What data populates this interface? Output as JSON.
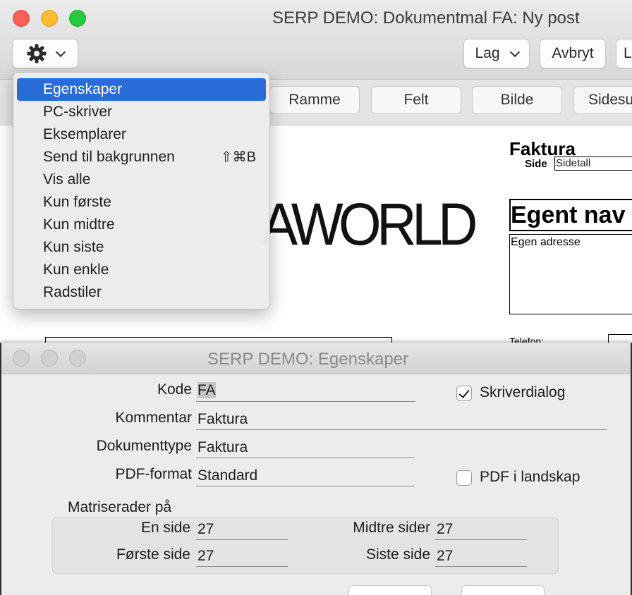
{
  "main_window": {
    "title": "SERP DEMO: Dokumentmal FA: Ny post",
    "toolbar": {
      "lag_label": "Lag",
      "avbryt_label": "Avbryt",
      "l_label": "L"
    },
    "tabs": [
      {
        "label": "Ramme"
      },
      {
        "label": "Felt"
      },
      {
        "label": "Bilde"
      },
      {
        "label": "Sidesu"
      }
    ],
    "document": {
      "logo_text": "AWORLD",
      "faktura_heading": "Faktura",
      "side_label": "Side",
      "sidetall_value": "Sidetall",
      "egent_navn": "Egent nav",
      "egen_adresse": "Egen adresse",
      "telefon_label": "Telefon:"
    }
  },
  "gear_menu": {
    "items": [
      {
        "label": "Egenskaper",
        "shortcut": "",
        "selected": true
      },
      {
        "label": "PC-skriver",
        "shortcut": ""
      },
      {
        "label": "Eksemplarer",
        "shortcut": ""
      },
      {
        "label": "Send til bakgrunnen",
        "shortcut": "⇧⌘B"
      },
      {
        "label": "Vis alle",
        "shortcut": ""
      },
      {
        "label": "Kun første",
        "shortcut": ""
      },
      {
        "label": "Kun midtre",
        "shortcut": ""
      },
      {
        "label": "Kun siste",
        "shortcut": ""
      },
      {
        "label": "Kun enkle",
        "shortcut": ""
      },
      {
        "label": "Radstiler",
        "shortcut": ""
      }
    ]
  },
  "props_window": {
    "title": "SERP DEMO: Egenskaper",
    "fields": {
      "kode_label": "Kode",
      "kode_value": "FA",
      "kommentar_label": "Kommentar",
      "kommentar_value": "Faktura",
      "dokumenttype_label": "Dokumenttype",
      "dokumenttype_value": "Faktura",
      "pdf_format_label": "PDF-format",
      "pdf_format_value": "Standard"
    },
    "checkboxes": {
      "skriverdialog_label": "Skriverdialog",
      "skriverdialog_checked": true,
      "pdf_landskap_label": "PDF i landskap",
      "pdf_landskap_checked": false
    },
    "matrix": {
      "heading": "Matriserader på",
      "en_side_label": "En side",
      "en_side_value": "27",
      "midtre_sider_label": "Midtre sider",
      "midtre_sider_value": "27",
      "forste_side_label": "Første side",
      "forste_side_value": "27",
      "siste_side_label": "Siste side",
      "siste_side_value": "27"
    }
  },
  "colors": {
    "close": "#fe5f57",
    "minimize": "#febc2e",
    "maximize": "#28c840",
    "menu_highlight": "#2b6bd8"
  }
}
